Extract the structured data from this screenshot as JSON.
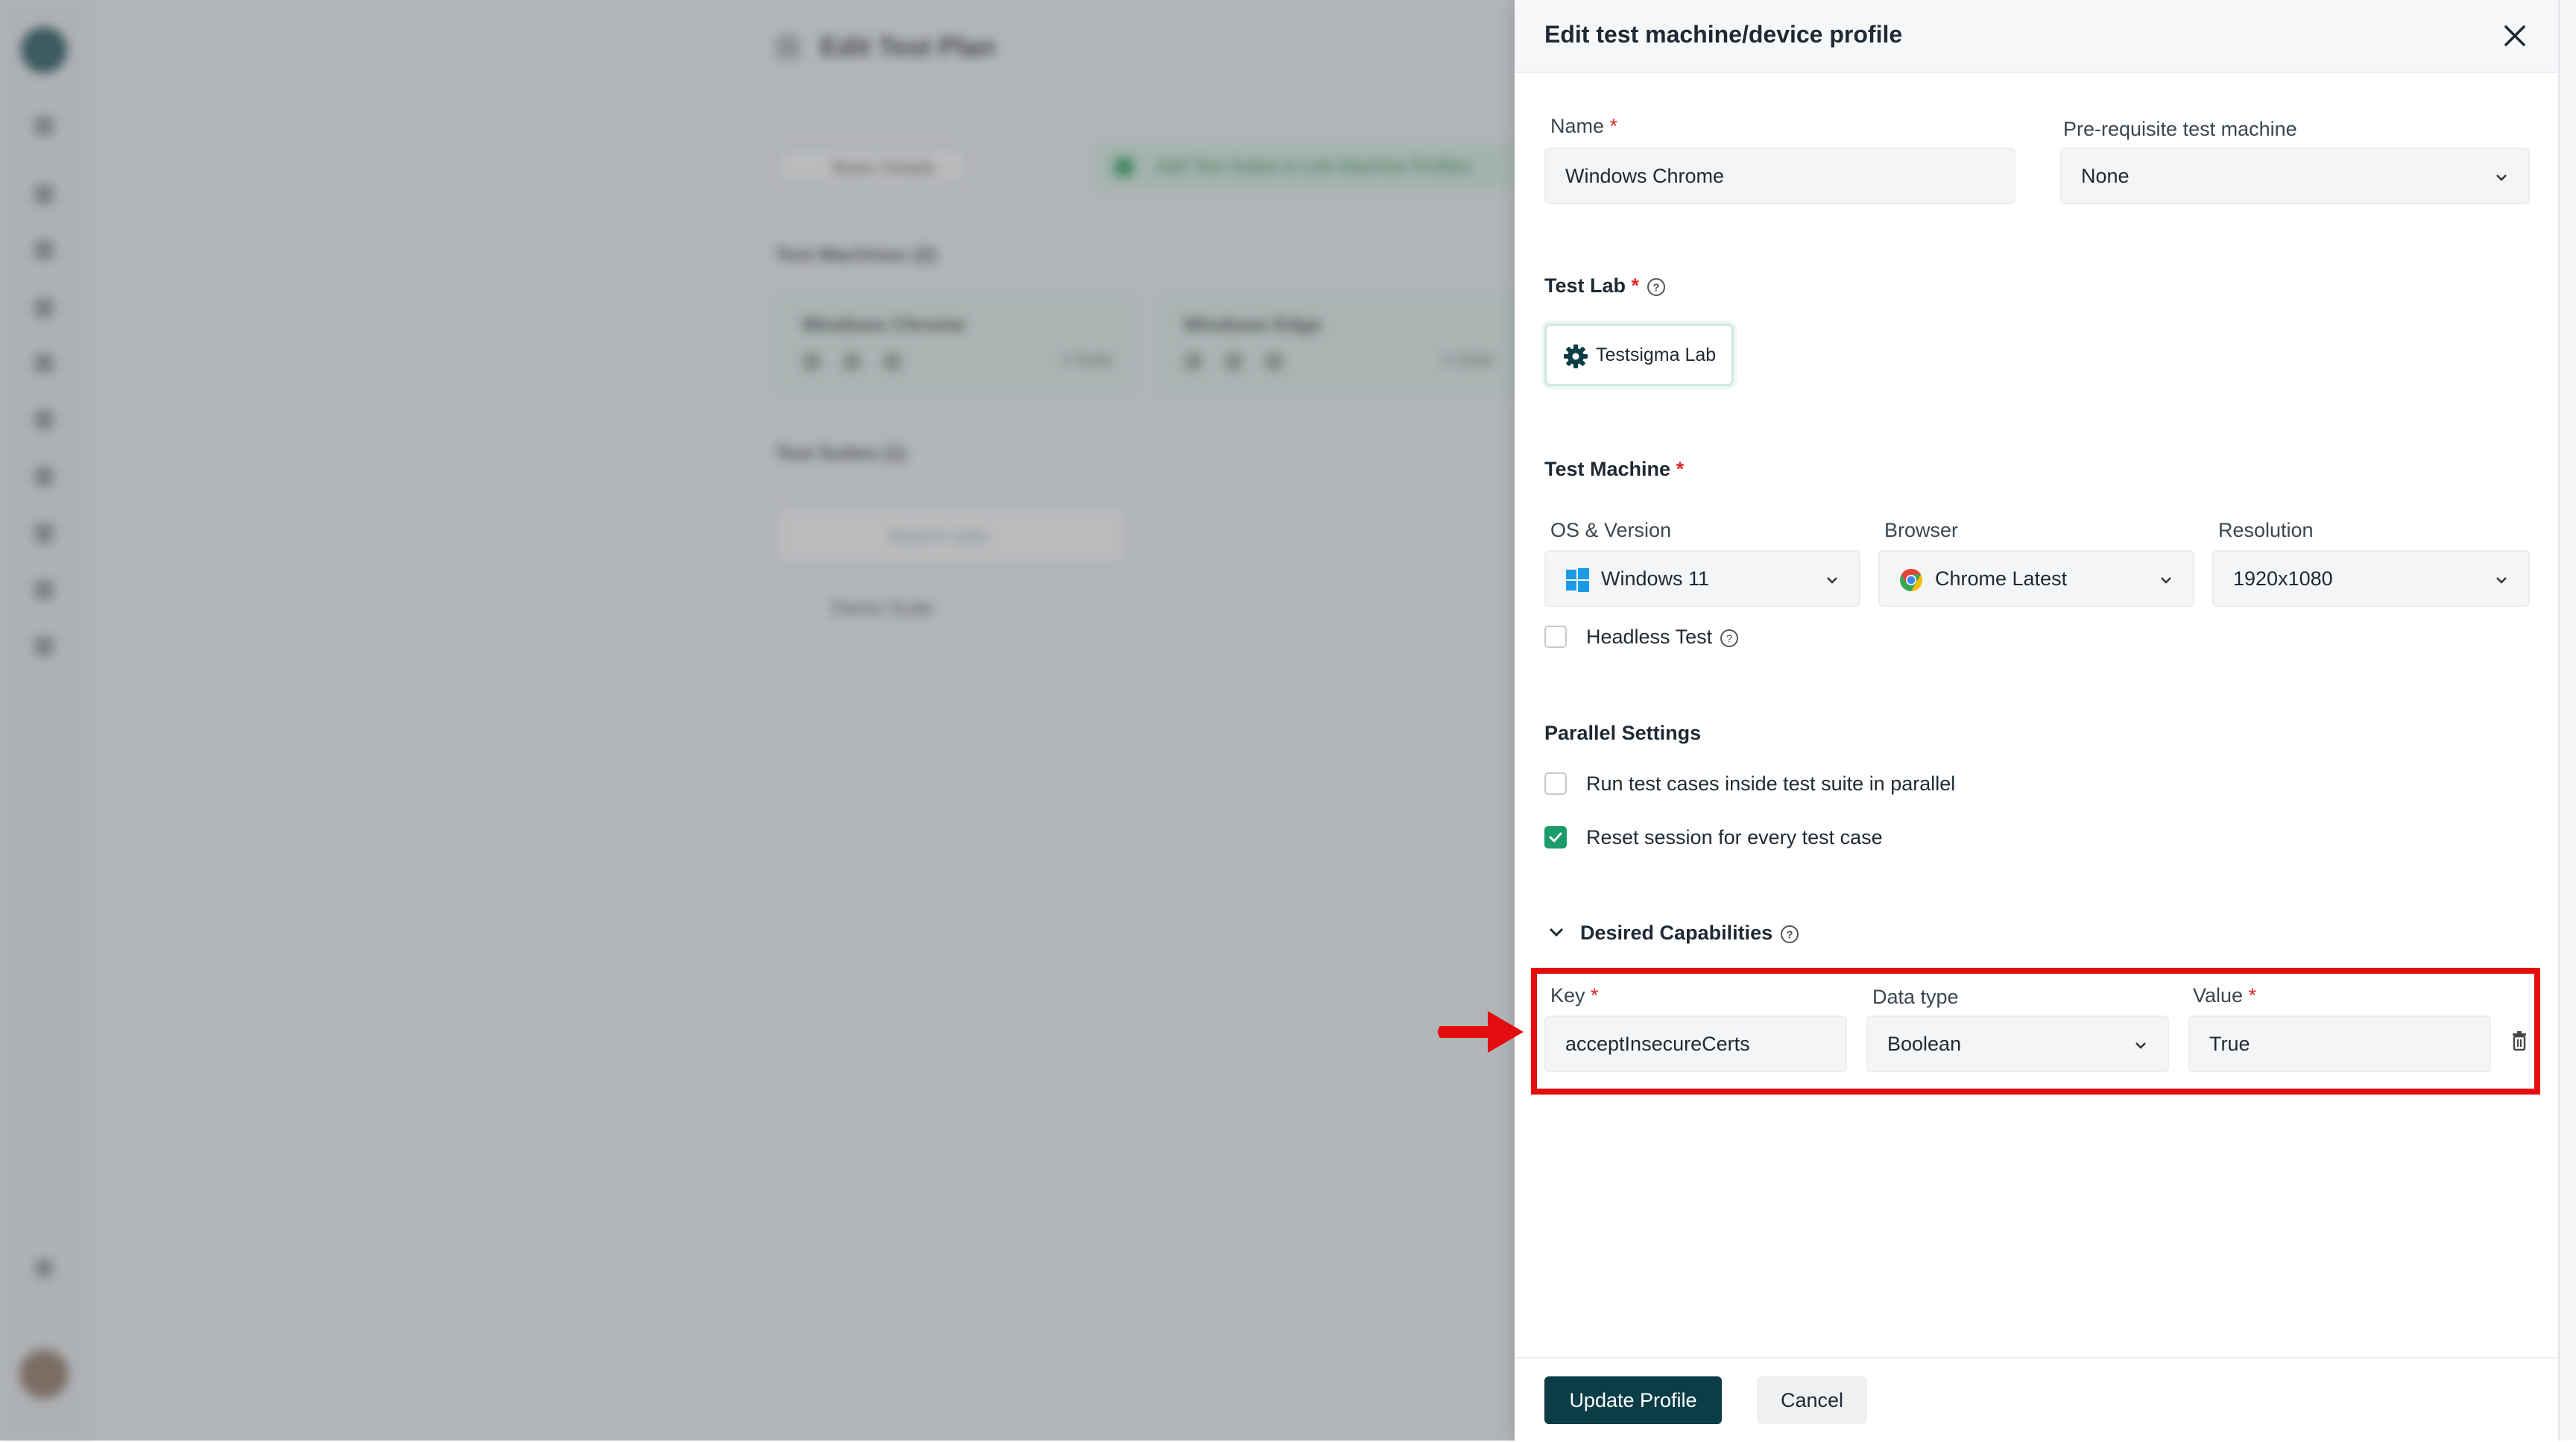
{
  "background": {
    "page_title": "Edit Test Plan",
    "back_label": "Basic Details",
    "banner_text": "Add Test Suites & Link Machine Profiles",
    "machines_heading": "Test Machines (2)",
    "machines": [
      {
        "name": "Windows Chrome",
        "suites": "1 Suite"
      },
      {
        "name": "Windows Edge",
        "suites": "1 Suite"
      }
    ],
    "suites_heading": "Test Suites (1)",
    "search_placeholder": "Search suite",
    "suite_item": "Demo Suite"
  },
  "panel": {
    "title": "Edit test machine/device profile",
    "name_label": "Name",
    "name_value": "Windows Chrome",
    "prereq_label": "Pre-requisite test machine",
    "prereq_value": "None",
    "test_lab_label": "Test Lab",
    "test_lab_value": "Testsigma Lab",
    "test_machine_label": "Test Machine",
    "os_label": "OS & Version",
    "os_value": "Windows 11",
    "browser_label": "Browser",
    "browser_value": "Chrome Latest",
    "resolution_label": "Resolution",
    "resolution_value": "1920x1080",
    "headless_label": "Headless Test",
    "headless_checked": false,
    "parallel_heading": "Parallel Settings",
    "parallel_run_label": "Run test cases inside test suite in parallel",
    "parallel_run_checked": false,
    "reset_session_label": "Reset session for every test case",
    "reset_session_checked": true,
    "capabilities_heading": "Desired Capabilities",
    "key_label": "Key",
    "key_value": "acceptInsecureCerts",
    "datatype_label": "Data type",
    "datatype_value": "Boolean",
    "value_label": "Value",
    "value_value": "True",
    "update_button": "Update Profile",
    "cancel_button": "Cancel"
  },
  "colors": {
    "primary": "#0b3d47",
    "checkbox_checked": "#1a9c6a",
    "required": "#e02424",
    "annotation": "#e30d10"
  }
}
